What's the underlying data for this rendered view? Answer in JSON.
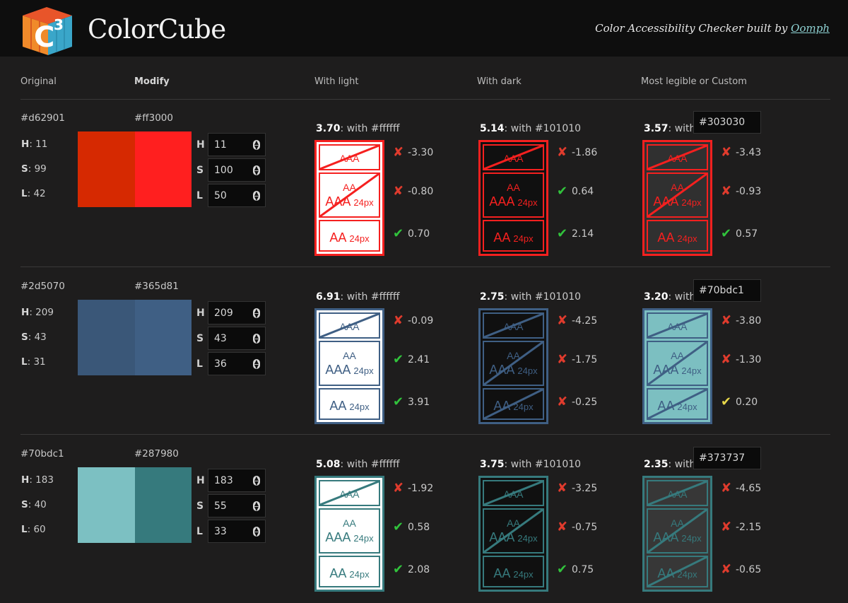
{
  "header": {
    "brand": "ColorCube",
    "logo_sup": "3",
    "logo_letter": "C",
    "tagline": "Color Accessibility Checker built by ",
    "tagline_link": "Oomph"
  },
  "columns": {
    "original": "Original",
    "modify": "Modify",
    "light": "With light",
    "dark": "With dark",
    "custom": "Most legible or Custom"
  },
  "labels": {
    "h": "H",
    "s": "S",
    "l": "L",
    "with": "with",
    "aa": "AA",
    "aaa": "AAA",
    "px24": "24px"
  },
  "rows": [
    {
      "original_hex": "#d62901",
      "original_color": "#d62901",
      "h": "11",
      "s": "99",
      "l": "42",
      "modified_hex": "#ff3000",
      "modified_color": "#ff1f1f",
      "mod_h": "11",
      "mod_s": "100",
      "mod_l": "50",
      "panels": [
        {
          "ratio": "3.70",
          "with_prefix": ": with #ffffff",
          "bg": "#ffffff",
          "fg": "#f5201f",
          "results": [
            {
              "icon": "fail",
              "delta": "-3.30"
            },
            {
              "icon": "fail",
              "delta": "-0.80"
            },
            {
              "icon": "pass",
              "delta": "0.70"
            }
          ]
        },
        {
          "ratio": "5.14",
          "with_prefix": ": with #101010",
          "bg": "#101010",
          "fg": "#f5201f",
          "results": [
            {
              "icon": "fail",
              "delta": "-1.86"
            },
            {
              "icon": "pass",
              "delta": "0.64"
            },
            {
              "icon": "pass",
              "delta": "2.14"
            }
          ]
        },
        {
          "ratio": "3.57",
          "with_prefix": ": with",
          "custom_value": "#303030",
          "bg": "#303030",
          "fg": "#f5201f",
          "results": [
            {
              "icon": "fail",
              "delta": "-3.43"
            },
            {
              "icon": "fail",
              "delta": "-0.93"
            },
            {
              "icon": "pass",
              "delta": "0.57"
            }
          ]
        }
      ]
    },
    {
      "original_hex": "#2d5070",
      "original_color": "#3a5778",
      "h": "209",
      "s": "43",
      "l": "31",
      "modified_hex": "#365d81",
      "modified_color": "#3f5f84",
      "mod_h": "209",
      "mod_s": "43",
      "mod_l": "36",
      "panels": [
        {
          "ratio": "6.91",
          "with_prefix": ": with #ffffff",
          "bg": "#ffffff",
          "fg": "#3f5f84",
          "results": [
            {
              "icon": "fail",
              "delta": "-0.09"
            },
            {
              "icon": "pass",
              "delta": "2.41"
            },
            {
              "icon": "pass",
              "delta": "3.91"
            }
          ]
        },
        {
          "ratio": "2.75",
          "with_prefix": ": with #101010",
          "bg": "#101010",
          "fg": "#3f5f84",
          "results": [
            {
              "icon": "fail",
              "delta": "-4.25"
            },
            {
              "icon": "fail",
              "delta": "-1.75"
            },
            {
              "icon": "fail",
              "delta": "-0.25"
            }
          ]
        },
        {
          "ratio": "3.20",
          "with_prefix": ": with",
          "custom_value": "#70bdc1",
          "bg": "#7cbfc1",
          "fg": "#3f5f84",
          "results": [
            {
              "icon": "fail",
              "delta": "-3.80"
            },
            {
              "icon": "fail",
              "delta": "-1.30"
            },
            {
              "icon": "warn",
              "delta": "0.20"
            }
          ]
        }
      ]
    },
    {
      "original_hex": "#70bdc1",
      "original_color": "#7cc0c2",
      "h": "183",
      "s": "40",
      "l": "60",
      "modified_hex": "#287980",
      "modified_color": "#367a7d",
      "mod_h": "183",
      "mod_s": "55",
      "mod_l": "33",
      "panels": [
        {
          "ratio": "5.08",
          "with_prefix": ": with #ffffff",
          "bg": "#ffffff",
          "fg": "#367a7d",
          "results": [
            {
              "icon": "fail",
              "delta": "-1.92"
            },
            {
              "icon": "pass",
              "delta": "0.58"
            },
            {
              "icon": "pass",
              "delta": "2.08"
            }
          ]
        },
        {
          "ratio": "3.75",
          "with_prefix": ": with #101010",
          "bg": "#101010",
          "fg": "#367a7d",
          "results": [
            {
              "icon": "fail",
              "delta": "-3.25"
            },
            {
              "icon": "fail",
              "delta": "-0.75"
            },
            {
              "icon": "pass",
              "delta": "0.75"
            }
          ]
        },
        {
          "ratio": "2.35",
          "with_prefix": ": with",
          "custom_value": "#373737",
          "bg": "#373737",
          "fg": "#367a7d",
          "results": [
            {
              "icon": "fail",
              "delta": "-4.65"
            },
            {
              "icon": "fail",
              "delta": "-2.15"
            },
            {
              "icon": "fail",
              "delta": "-0.65"
            }
          ]
        }
      ]
    }
  ],
  "icons": {
    "fail": "✘",
    "pass": "✔",
    "warn": "✔"
  }
}
